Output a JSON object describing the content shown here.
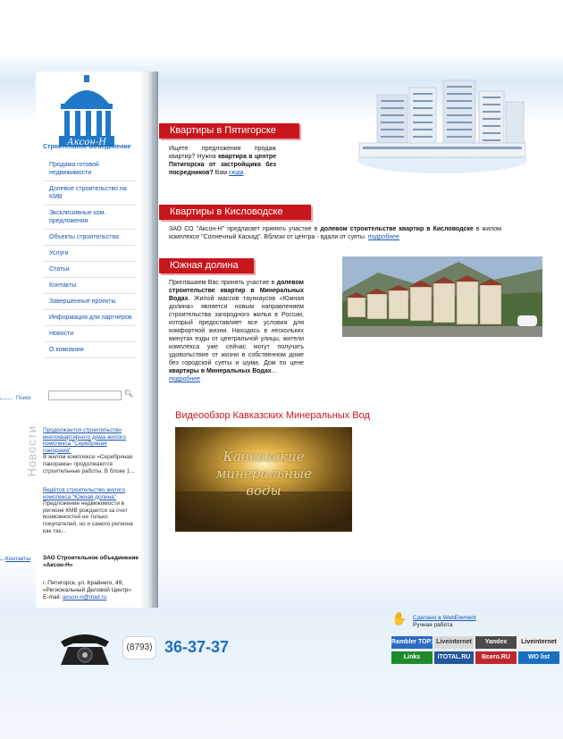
{
  "brand": {
    "logo_text": "Аксон-Н",
    "subtitle": "Строительное объединение"
  },
  "nav": {
    "items": [
      {
        "label": "Продажа готовой недвижимости"
      },
      {
        "label": "Долевое строительство на КМВ"
      },
      {
        "label": "Эксклюзивные ком. предложения"
      },
      {
        "label": "Объекты строительства"
      },
      {
        "label": "Услуги"
      },
      {
        "label": "Статьи"
      },
      {
        "label": "Контакты"
      },
      {
        "label": "Завершенные проекты"
      },
      {
        "label": "Информация для партнеров"
      },
      {
        "label": "Новости"
      },
      {
        "label": "О компании"
      }
    ]
  },
  "search": {
    "label": "Поиск",
    "placeholder": ""
  },
  "news": {
    "title": "Новости",
    "items": [
      {
        "link": "Продолжается строительство многоквартирного дома жилого комплекса \"Серебряная панорама\"",
        "text": "В жилом комплексе «Серебряная панорама» продолжаются строительные работы. В блоке 1..."
      },
      {
        "link": "Ведётся строительство жилого комплекса \"Южная долина\"",
        "text": "Предложение недвижимости в регионе КМВ рождается за счет возможностей не только покупателей, но и самого региона как так..."
      }
    ]
  },
  "contacts": {
    "label": "Контакты",
    "company_name": "ЗАО Строительное объединение «Аксон-Н»",
    "address": "г. Пятигорск, ул. Крайнего, 49, «Региональный Деловой Центр»",
    "email_label": "E-mail:",
    "email": "axson-n@mail.ru"
  },
  "sections": [
    {
      "heading": "Квартиры в Пятигорске",
      "pre": "Ищете предложения продаж квартир? Нужна ",
      "bold": "квартира в центре Пятигорска от застройщика без посредников?",
      "post": " Вам ",
      "link": "сюда"
    },
    {
      "heading": "Квартиры в Кисловодске",
      "pre": "ЗАО СО \"Аксон-Н\" предлагает принять участие в ",
      "bold": "долевом строительстве квартир в Кисловодске",
      "post": " в жилом комплексе \"Солнечный Каскад\". Вблизи от центра - вдали от суеты. ",
      "link": "подробнее"
    },
    {
      "heading": "Южная долина",
      "pre": "Приглашаем Вас принять участие в ",
      "bold": "долевом строительстве квартир в Минеральных Водах",
      "post": ". Жилой массив таунхаусов «Южная долина» является новым направлением строительства загородного жилья в России, который предоставляет все условия для комфортной жизни. Находясь в нескольких минутах езды от центральной улицы, жители комплекса уже сейчас могут получать удовольствие от жизни в собственном доме без городской суеты и шума. Дом по цене ",
      "bold2": "квартиры в Минеральных Водах",
      "post2": "...",
      "link": "подробнее"
    }
  ],
  "video": {
    "title": "Видеообзор Кавказских Минеральных Вод",
    "overlay_line1": "Кавказские",
    "overlay_line2": "минеральные",
    "overlay_line3": "воды"
  },
  "phone": {
    "code": "(8793)",
    "number": "36-37-37"
  },
  "madeby": {
    "link": "Сделано в WebElement",
    "sub": "Ручная работа"
  },
  "counters": [
    {
      "label": "Rambler TOP100",
      "color": "#2b6cc4"
    },
    {
      "label": "Liveinternet",
      "color": "#d9d9d9"
    },
    {
      "label": "Yandex",
      "color": "#4a4a4a"
    },
    {
      "label": "Liveinternet",
      "color": "#f0f0f0"
    },
    {
      "label": "Links",
      "color": "#1f8a2c"
    },
    {
      "label": "iTOTAL.RU",
      "color": "#225599"
    },
    {
      "label": "Всего.RU",
      "color": "#c0272d"
    },
    {
      "label": "WO list",
      "color": "#1a6fc0"
    }
  ]
}
